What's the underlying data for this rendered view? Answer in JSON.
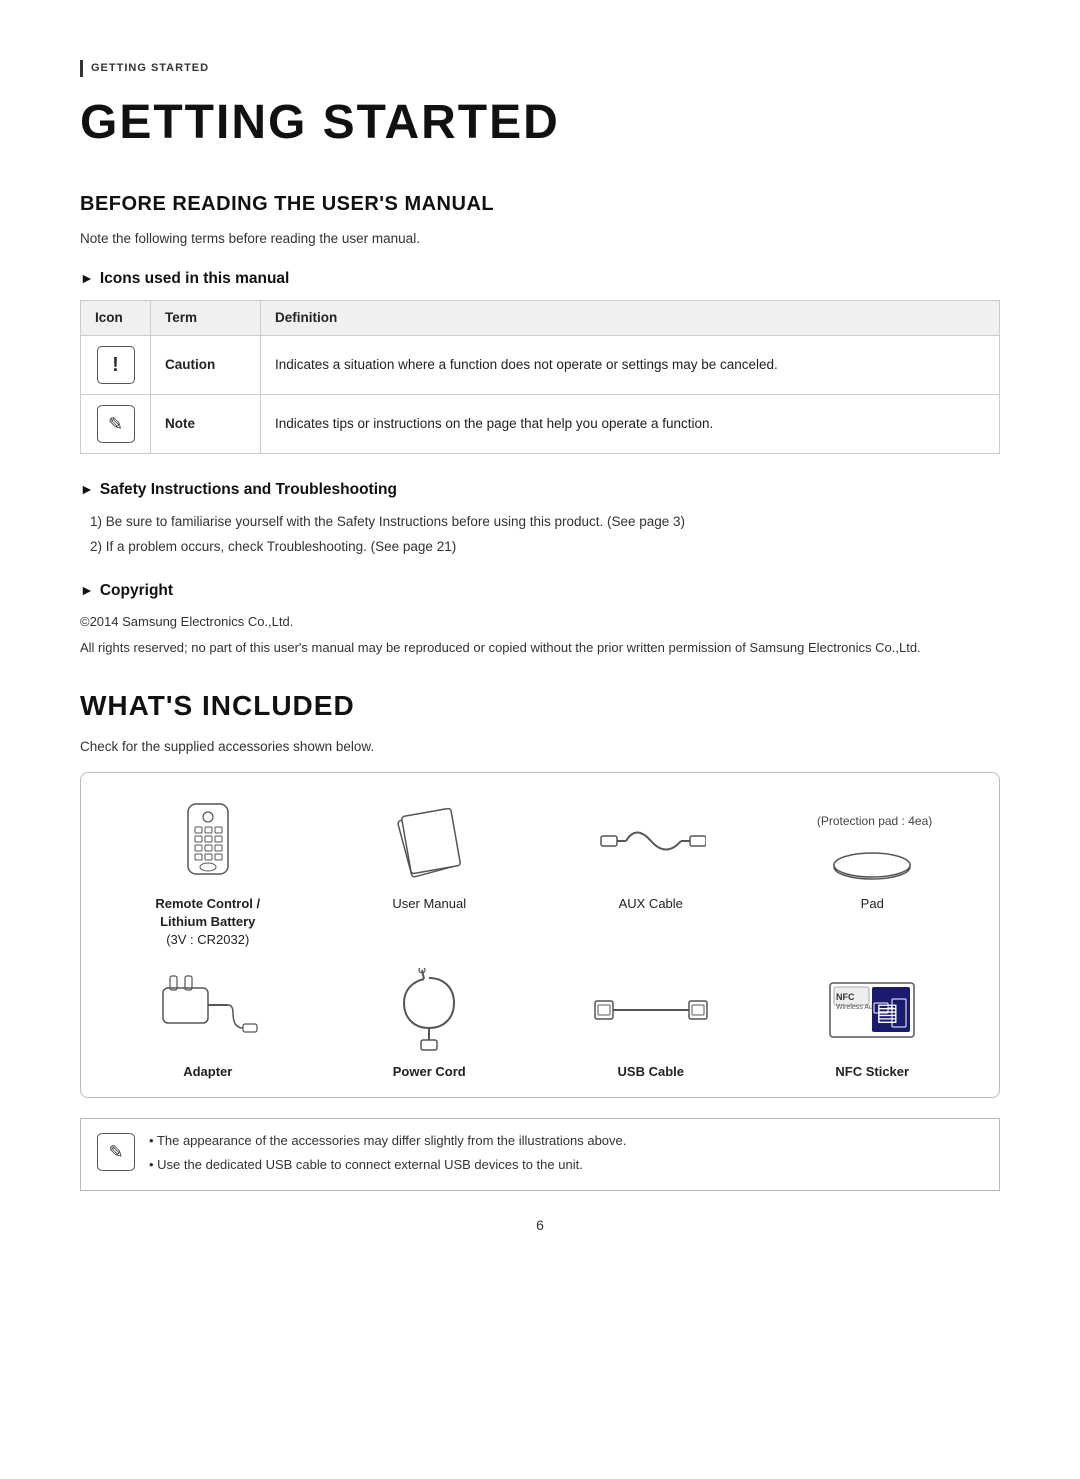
{
  "header": {
    "section_label": "GETTING STARTED",
    "page_title": "GETTING STARTED"
  },
  "before_reading": {
    "heading": "BEFORE READING THE USER'S MANUAL",
    "intro": "Note the following terms before reading the user manual.",
    "icons_section": {
      "heading": "Icons used in this manual",
      "table": {
        "col_icon": "Icon",
        "col_term": "Term",
        "col_def": "Definition",
        "rows": [
          {
            "icon_type": "caution",
            "term": "Caution",
            "definition": "Indicates a situation where a function does not operate or settings may be canceled."
          },
          {
            "icon_type": "note",
            "term": "Note",
            "definition": "Indicates tips or instructions on the page that help you operate a function."
          }
        ]
      }
    },
    "safety_section": {
      "heading": "Safety Instructions and Troubleshooting",
      "items": [
        "1)  Be sure to familiarise yourself with the Safety Instructions before using this product. (See page 3)",
        "2)  If a problem occurs, check Troubleshooting. (See page 21)"
      ]
    },
    "copyright_section": {
      "heading": "Copyright",
      "lines": [
        "©2014 Samsung Electronics Co.,Ltd.",
        "All rights reserved; no part of this user's manual may be reproduced or copied without the prior written permission of Samsung Electronics Co.,Ltd."
      ]
    }
  },
  "whats_included": {
    "heading": "WHAT'S INCLUDED",
    "intro": "Check for the supplied accessories shown below.",
    "accessories": [
      {
        "id": "remote-control",
        "label": "Remote Control /\nLithium Battery\n(3V : CR2032)",
        "label_bold": false
      },
      {
        "id": "user-manual",
        "label": "User Manual",
        "label_bold": false
      },
      {
        "id": "aux-cable",
        "label": "AUX Cable",
        "label_bold": false
      },
      {
        "id": "pad",
        "label": "Pad",
        "label_bold": false,
        "note": "(Protection pad : 4ea)"
      },
      {
        "id": "adapter",
        "label": "Adapter",
        "label_bold": true
      },
      {
        "id": "power-cord",
        "label": "Power Cord",
        "label_bold": true
      },
      {
        "id": "usb-cable",
        "label": "USB Cable",
        "label_bold": true
      },
      {
        "id": "nfc-sticker",
        "label": "NFC Sticker",
        "label_bold": true
      }
    ],
    "notes": [
      "The appearance of the accessories may differ slightly from the illustrations above.",
      "Use the dedicated USB cable to connect external USB devices to the unit."
    ]
  },
  "page_number": "6"
}
